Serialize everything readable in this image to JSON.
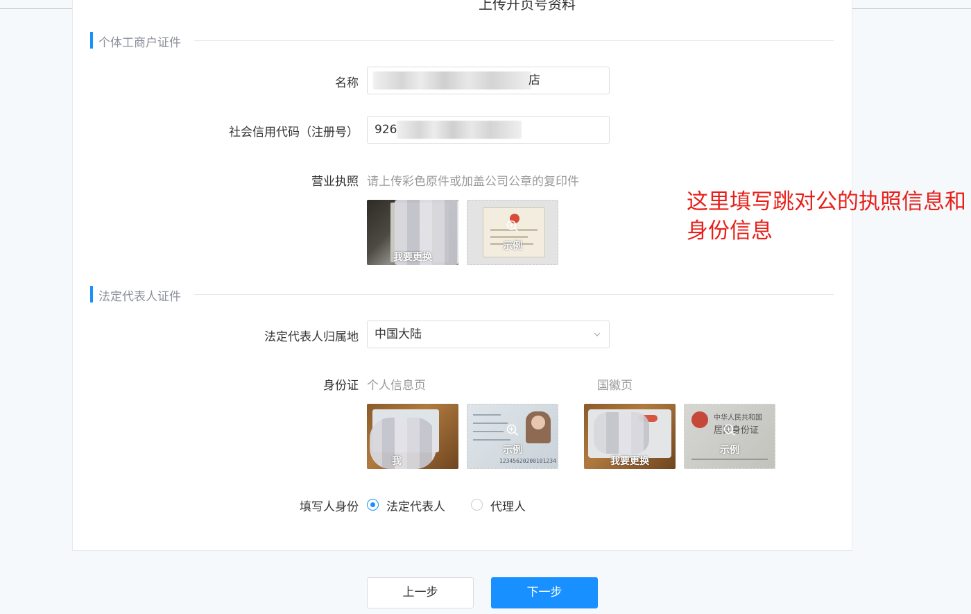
{
  "page": {
    "title_partial": "上传开页号资料"
  },
  "business_section": {
    "title": "个体工商户证件",
    "name_label": "名称",
    "name_value_tail": "店",
    "credit_label": "社会信用代码（注册号）",
    "credit_value_prefix": "926",
    "license_label": "营业执照",
    "license_hint": "请上传彩色原件或加盖公司公章的复印件",
    "license_uploaded_text": "我要更换",
    "license_sample_text": "示例"
  },
  "legal_section": {
    "title": "法定代表人证件",
    "region_label": "法定代表人归属地",
    "region_value": "中国大陆",
    "id_label": "身份证",
    "front_hint": "个人信息页",
    "back_hint": "国徽页",
    "front_uploaded_text": "我",
    "front_sample_text": "示例",
    "back_uploaded_text": "我要更换",
    "back_sample_text": "示例",
    "id_sample_number": "12345620200101234",
    "emblem_line1": "中华人民共和国",
    "emblem_line2": "居民身份证",
    "role_label": "填写人身份",
    "role_options": [
      "法定代表人",
      "代理人"
    ],
    "role_selected": "法定代表人"
  },
  "annotation": {
    "text": "这里填写跳对公的执照信息和身份信息",
    "color": "#e8201a"
  },
  "buttons": {
    "prev": "上一步",
    "next": "下一步"
  },
  "colors": {
    "accent": "#1890ff"
  }
}
